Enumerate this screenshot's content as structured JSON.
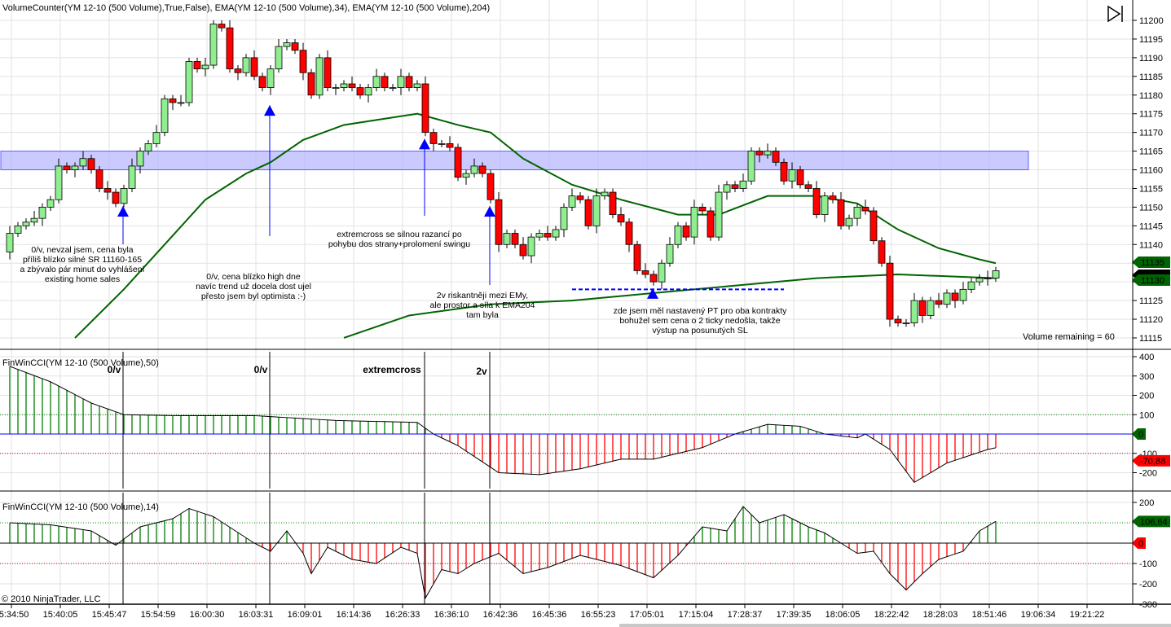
{
  "chart_data": {
    "type": "candlestick",
    "title": "VolumeCounter(YM 12-10 (500 Volume),True,False), EMA(YM 12-10 (500 Volume),34), EMA(YM 12-10 (500 Volume),204)",
    "ylim": [
      11113,
      11202
    ],
    "y_ticks": [
      11115,
      11120,
      11125,
      11130,
      11135,
      11140,
      11145,
      11150,
      11155,
      11160,
      11165,
      11170,
      11175,
      11180,
      11185,
      11190,
      11195,
      11200
    ],
    "closes": [
      11143,
      11145,
      11146,
      11147,
      11150,
      11152,
      11161,
      11160,
      11161,
      11163,
      11160,
      11155,
      11154,
      11151,
      11155,
      11161,
      11165,
      11167,
      11170,
      11179,
      11178,
      11178,
      11189,
      11187,
      11188,
      11199,
      11198,
      11187,
      11186,
      11190,
      11185,
      11182,
      11187,
      11193,
      11194,
      11192,
      11186,
      11180,
      11190,
      11182,
      11182,
      11183,
      11182,
      11180,
      11182,
      11185,
      11182,
      11182,
      11185,
      11182,
      11183,
      11170,
      11167,
      11167,
      11166,
      11158,
      11159,
      11161,
      11159,
      11152,
      11140,
      11143,
      11140,
      11137,
      11142,
      11143,
      11142,
      11144,
      11150,
      11153,
      11152,
      11145,
      11153,
      11154,
      11148,
      11146,
      11140,
      11133,
      11132,
      11130,
      11135,
      11140,
      11145,
      11142,
      11150,
      11149,
      11142,
      11154,
      11156,
      11155,
      11157,
      11165,
      11164,
      11165,
      11162,
      11157,
      11160,
      11156,
      11155,
      11148,
      11153,
      11152,
      11145,
      11147,
      11150,
      11149,
      11141,
      11135,
      11120,
      11119,
      11119,
      11125,
      11121,
      11125,
      11124,
      11127,
      11125,
      11128,
      11130,
      11131,
      11131,
      11133
    ],
    "first_open": 11138,
    "ema34": [
      [
        8,
        11115
      ],
      [
        14,
        11128
      ],
      [
        19,
        11140
      ],
      [
        24,
        11152
      ],
      [
        29,
        11159
      ],
      [
        32,
        11162
      ],
      [
        36,
        11168
      ],
      [
        41,
        11172
      ],
      [
        47,
        11174
      ],
      [
        50,
        11175
      ],
      [
        55,
        11172
      ],
      [
        59,
        11170
      ],
      [
        63,
        11163
      ],
      [
        69,
        11156
      ],
      [
        75,
        11152
      ],
      [
        82,
        11148
      ],
      [
        87,
        11148
      ],
      [
        93,
        11153
      ],
      [
        99,
        11153
      ],
      [
        104,
        11151
      ],
      [
        109,
        11144
      ],
      [
        114,
        11139
      ],
      [
        119,
        11136
      ],
      [
        121,
        11135
      ]
    ],
    "ema204": [
      [
        41,
        11115
      ],
      [
        49,
        11121
      ],
      [
        59,
        11124
      ],
      [
        69,
        11125
      ],
      [
        79,
        11127
      ],
      [
        89,
        11129
      ],
      [
        99,
        11131
      ],
      [
        109,
        11132
      ],
      [
        121,
        11131
      ]
    ],
    "sr_zone": [
      11160,
      11165
    ],
    "pt_line": {
      "price": 11128,
      "from_bar": 69,
      "to_bar": 95
    },
    "arrows": [
      [
        14,
        11149
      ],
      [
        32,
        11176
      ],
      [
        51,
        11167
      ],
      [
        59,
        11149
      ],
      [
        79,
        11127
      ]
    ],
    "signal_bars": [
      14,
      32,
      51,
      59
    ],
    "x_ticks": [
      "15:34:50",
      "15:40:05",
      "15:45:47",
      "15:54:59",
      "16:00:30",
      "16:03:31",
      "16:09:01",
      "16:14:36",
      "16:26:33",
      "16:36:10",
      "16:42:36",
      "16:45:36",
      "16:55:23",
      "17:05:01",
      "17:15:04",
      "17:28:37",
      "17:39:35",
      "18:06:05",
      "18:22:42",
      "18:28:03",
      "18:51:46",
      "19:06:34",
      "19:21:22"
    ],
    "price_markers": [
      {
        "value": "11135",
        "color": "#006400"
      },
      {
        "value": "11132",
        "color": "#000000"
      },
      {
        "value": "11130",
        "color": "#006400"
      }
    ],
    "volume_remaining": "Volume remaining = 60",
    "annotations": [
      [
        "0/v, nevzal jsem, cena byla",
        "příliš blízko silné SR 11160-165",
        "a zbývalo pár minut do vyhlášení",
        "existing home sales"
      ],
      [
        "0/v, cena blízko high dne",
        "navíc trend už docela dost ujel",
        "přesto jsem byl optimista :-)"
      ],
      [
        "extremcross se silnou razancí po",
        "pohybu dos strany+prolomení swingu"
      ],
      [
        "2v riskantněji mezi EMy,",
        "ale prostor a síla k EMA204",
        "tam byla"
      ],
      [
        "zde jsem měl nastavený PT pro oba kontrakty",
        "bohužel sem cena o 2 ticky nedošla, takže",
        "výstup na posunutých SL"
      ]
    ],
    "cci50": {
      "title": "FinWinCCI(YM 12-10 (500 Volume),50)",
      "ylim": [
        -230,
        430
      ],
      "y_ticks": [
        400,
        300,
        200,
        100,
        -100,
        -200
      ],
      "levels": [
        100,
        0,
        -100
      ],
      "keypoints": [
        [
          0,
          350
        ],
        [
          5,
          270
        ],
        [
          10,
          160
        ],
        [
          14,
          100
        ],
        [
          20,
          95
        ],
        [
          30,
          95
        ],
        [
          40,
          70
        ],
        [
          50,
          60
        ],
        [
          52,
          0
        ],
        [
          55,
          -60
        ],
        [
          60,
          -200
        ],
        [
          65,
          -210
        ],
        [
          70,
          -180
        ],
        [
          75,
          -130
        ],
        [
          79,
          -130
        ],
        [
          85,
          -70
        ],
        [
          89,
          0
        ],
        [
          93,
          50
        ],
        [
          97,
          40
        ],
        [
          100,
          0
        ],
        [
          104,
          -20
        ],
        [
          105,
          0
        ],
        [
          108,
          -80
        ],
        [
          111,
          -250
        ],
        [
          115,
          -150
        ],
        [
          120,
          -80
        ],
        [
          121,
          -70.88
        ]
      ],
      "zero_marker": "0",
      "last_marker": "-70,88",
      "signal_labels": [
        "0/v",
        "0/v",
        "extremcross",
        "2v"
      ]
    },
    "cci14": {
      "title": "FinWinCCI(YM 12-10 (500 Volume),14)",
      "ylim": [
        -300,
        250
      ],
      "y_ticks": [
        200,
        -100,
        -200,
        -300
      ],
      "levels": [
        100,
        0,
        -100
      ],
      "keypoints": [
        [
          0,
          100
        ],
        [
          5,
          90
        ],
        [
          10,
          60
        ],
        [
          13,
          -10
        ],
        [
          16,
          80
        ],
        [
          20,
          120
        ],
        [
          22,
          170
        ],
        [
          25,
          130
        ],
        [
          30,
          0
        ],
        [
          32,
          -40
        ],
        [
          34,
          60
        ],
        [
          36,
          -50
        ],
        [
          37,
          -150
        ],
        [
          39,
          -20
        ],
        [
          42,
          -80
        ],
        [
          45,
          -100
        ],
        [
          48,
          -20
        ],
        [
          50,
          -50
        ],
        [
          51,
          -270
        ],
        [
          53,
          -130
        ],
        [
          55,
          -150
        ],
        [
          57,
          -100
        ],
        [
          60,
          -50
        ],
        [
          63,
          -150
        ],
        [
          66,
          -120
        ],
        [
          70,
          -60
        ],
        [
          75,
          -110
        ],
        [
          79,
          -170
        ],
        [
          82,
          -60
        ],
        [
          85,
          80
        ],
        [
          88,
          60
        ],
        [
          90,
          180
        ],
        [
          92,
          100
        ],
        [
          95,
          140
        ],
        [
          98,
          80
        ],
        [
          100,
          50
        ],
        [
          102,
          0
        ],
        [
          104,
          -50
        ],
        [
          106,
          -40
        ],
        [
          108,
          -150
        ],
        [
          110,
          -230
        ],
        [
          112,
          -150
        ],
        [
          114,
          -80
        ],
        [
          117,
          -40
        ],
        [
          119,
          60
        ],
        [
          121,
          106.64
        ]
      ],
      "zero_marker": "0",
      "last_marker": "106,64"
    },
    "copyright": "© 2010 NinjaTrader, LLC",
    "colors": {
      "up": "#90EE90",
      "down": "#FF0000",
      "ema": "#006400",
      "zone": "#8080FF",
      "arrow": "#0000FF"
    }
  }
}
